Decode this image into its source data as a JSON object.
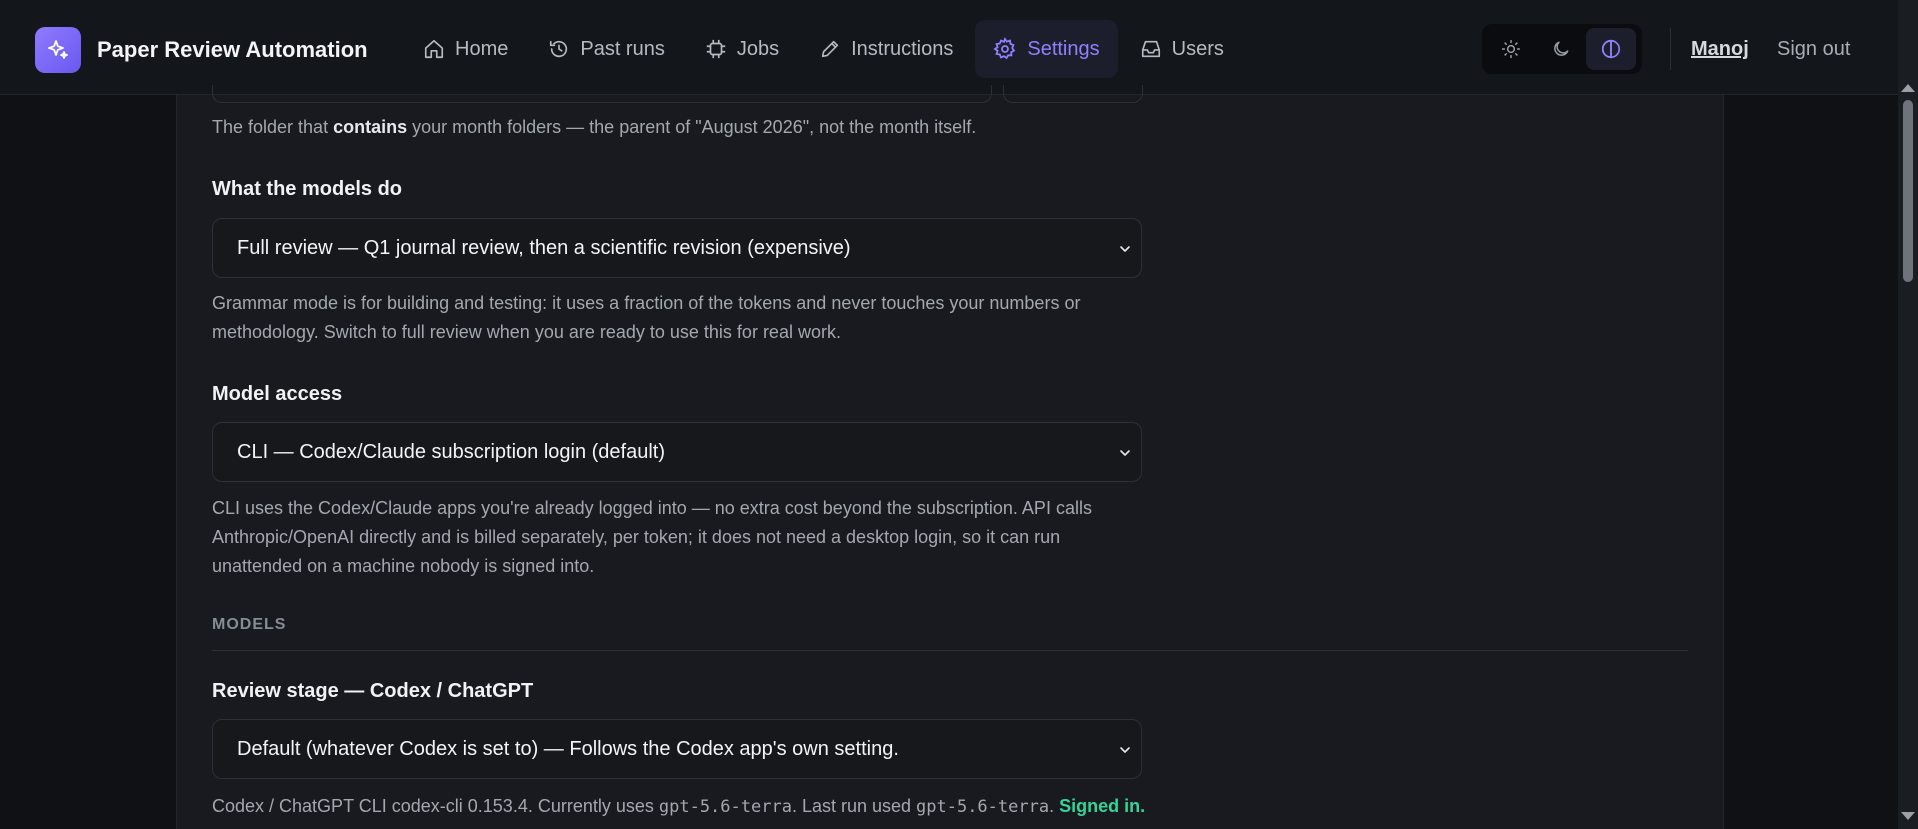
{
  "app": {
    "title": "Paper Review Automation",
    "accent_color": "#8f80ff",
    "logo_icon": "sparkles-icon"
  },
  "nav": {
    "items": [
      {
        "label": "Home",
        "icon": "home-icon"
      },
      {
        "label": "Past runs",
        "icon": "history-icon"
      },
      {
        "label": "Jobs",
        "icon": "chip-icon"
      },
      {
        "label": "Instructions",
        "icon": "pen-icon"
      },
      {
        "label": "Settings",
        "icon": "gear-icon",
        "active": true
      },
      {
        "label": "Users",
        "icon": "inbox-icon"
      }
    ]
  },
  "theme": {
    "options": [
      "light",
      "dark",
      "system"
    ],
    "selected": "system"
  },
  "user": {
    "name": "Manoj",
    "signout_label": "Sign out"
  },
  "settings": {
    "folder_help_prefix": "The folder that ",
    "folder_help_bold": "contains",
    "folder_help_suffix": " your month folders — the parent of \"August 2026\", not the month itself.",
    "models_do": {
      "label": "What the models do",
      "value": "Full review — Q1 journal review, then a scientific revision (expensive)",
      "help": "Grammar mode is for building and testing: it uses a fraction of the tokens and never touches your numbers or methodology. Switch to full review when you are ready to use this for real work."
    },
    "model_access": {
      "label": "Model access",
      "value": "CLI — Codex/Claude subscription login (default)",
      "help": "CLI uses the Codex/Claude apps you're already logged into — no extra cost beyond the subscription. API calls Anthropic/OpenAI directly and is billed separately, per token; it does not need a desktop login, so it can run unattended on a machine nobody is signed into."
    },
    "models_section": "MODELS",
    "review_stage": {
      "label": "Review stage — Codex / ChatGPT",
      "value": "Default (whatever Codex is set to) — Follows the Codex app's own setting.",
      "help_prefix": "Codex / ChatGPT CLI codex-cli 0.153.4. Currently uses ",
      "model_current": "gpt-5.6-terra",
      "help_mid": ". Last run used ",
      "model_last": "gpt-5.6-terra",
      "help_end": ". ",
      "status": "Signed in.",
      "status_color": "#34d399"
    }
  }
}
